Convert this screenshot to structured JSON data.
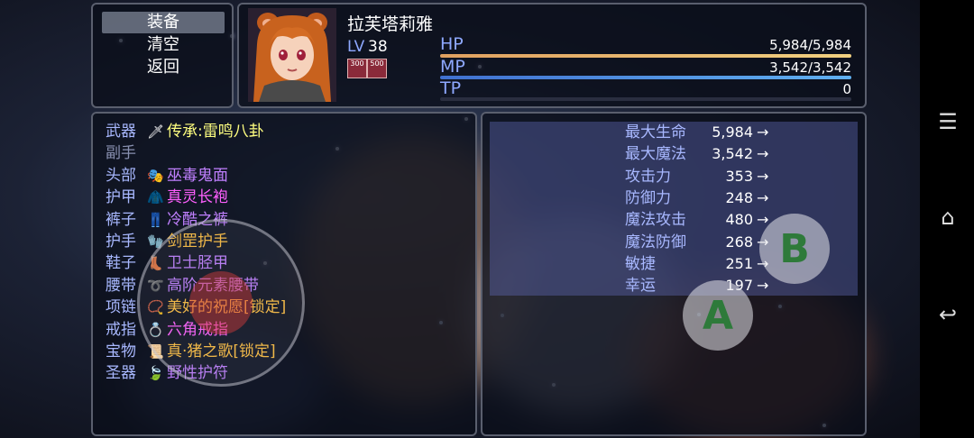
{
  "menu": {
    "items": [
      {
        "label": "装备",
        "selected": true
      },
      {
        "label": "清空",
        "selected": false
      },
      {
        "label": "返回",
        "selected": false
      }
    ]
  },
  "actor": {
    "name": "拉芙塔莉雅",
    "level_label": "LV",
    "level": "38",
    "state_badges": [
      "300",
      "500"
    ],
    "hp": {
      "label": "HP",
      "value": "5,984/5,984",
      "ratio": 1.0,
      "color_a": "#e0a060",
      "color_b": "#f0d080"
    },
    "mp": {
      "label": "MP",
      "value": "3,542/3,542",
      "ratio": 1.0,
      "color_a": "#4070d0",
      "color_b": "#60b0f0"
    },
    "tp": {
      "label": "TP",
      "value": "0",
      "ratio": 0.0,
      "color_a": "#40a040",
      "color_b": "#80e080"
    }
  },
  "equipment": [
    {
      "type": "武器",
      "icon": "feather-sword-icon",
      "glyph": "🗡",
      "name": "传承:雷鸣八卦",
      "color": "#ffff80"
    },
    {
      "type": "副手",
      "icon": "",
      "glyph": "",
      "name": "",
      "color": "#ffffff",
      "dim": true
    },
    {
      "type": "头部",
      "icon": "mask-icon",
      "glyph": "🎭",
      "name": "巫毒鬼面",
      "color": "#c080ff"
    },
    {
      "type": "护甲",
      "icon": "robe-icon",
      "glyph": "🧥",
      "name": "真灵长袍",
      "color": "#ff60ff"
    },
    {
      "type": "裤子",
      "icon": "pants-icon",
      "glyph": "👖",
      "name": "冷酷之裤",
      "color": "#c080ff"
    },
    {
      "type": "护手",
      "icon": "gauntlet-icon",
      "glyph": "🧤",
      "name": "剑罡护手",
      "color": "#ffc040"
    },
    {
      "type": "鞋子",
      "icon": "boots-icon",
      "glyph": "👢",
      "name": "卫士胫甲",
      "color": "#c080ff"
    },
    {
      "type": "腰带",
      "icon": "belt-icon",
      "glyph": "➰",
      "name": "高阶元素腰带",
      "color": "#c080ff"
    },
    {
      "type": "项链",
      "icon": "necklace-icon",
      "glyph": "📿",
      "name": "美好的祝愿[锁定]",
      "color": "#ffc040"
    },
    {
      "type": "戒指",
      "icon": "ring-icon",
      "glyph": "💍",
      "name": "六角戒指",
      "color": "#ff60ff"
    },
    {
      "type": "宝物",
      "icon": "scroll-icon",
      "glyph": "📜",
      "name": "真·猪之歌[锁定]",
      "color": "#ffc040"
    },
    {
      "type": "圣器",
      "icon": "leaf-icon",
      "glyph": "🍃",
      "name": "野性护符",
      "color": "#c080ff"
    }
  ],
  "stats": [
    {
      "name": "最大生命",
      "value": "5,984",
      "arrow": "→"
    },
    {
      "name": "最大魔法",
      "value": "3,542",
      "arrow": "→"
    },
    {
      "name": "攻击力",
      "value": "353",
      "arrow": "→"
    },
    {
      "name": "防御力",
      "value": "248",
      "arrow": "→"
    },
    {
      "name": "魔法攻击",
      "value": "480",
      "arrow": "→"
    },
    {
      "name": "魔法防御",
      "value": "268",
      "arrow": "→"
    },
    {
      "name": "敏捷",
      "value": "251",
      "arrow": "→"
    },
    {
      "name": "幸运",
      "value": "197",
      "arrow": "→"
    }
  ],
  "virtual_buttons": {
    "a": "A",
    "b": "B",
    "color": "#2e7a3a"
  },
  "system_nav": {
    "menu_icon": "☰",
    "home_icon": "⌂",
    "back_icon": "↩"
  }
}
